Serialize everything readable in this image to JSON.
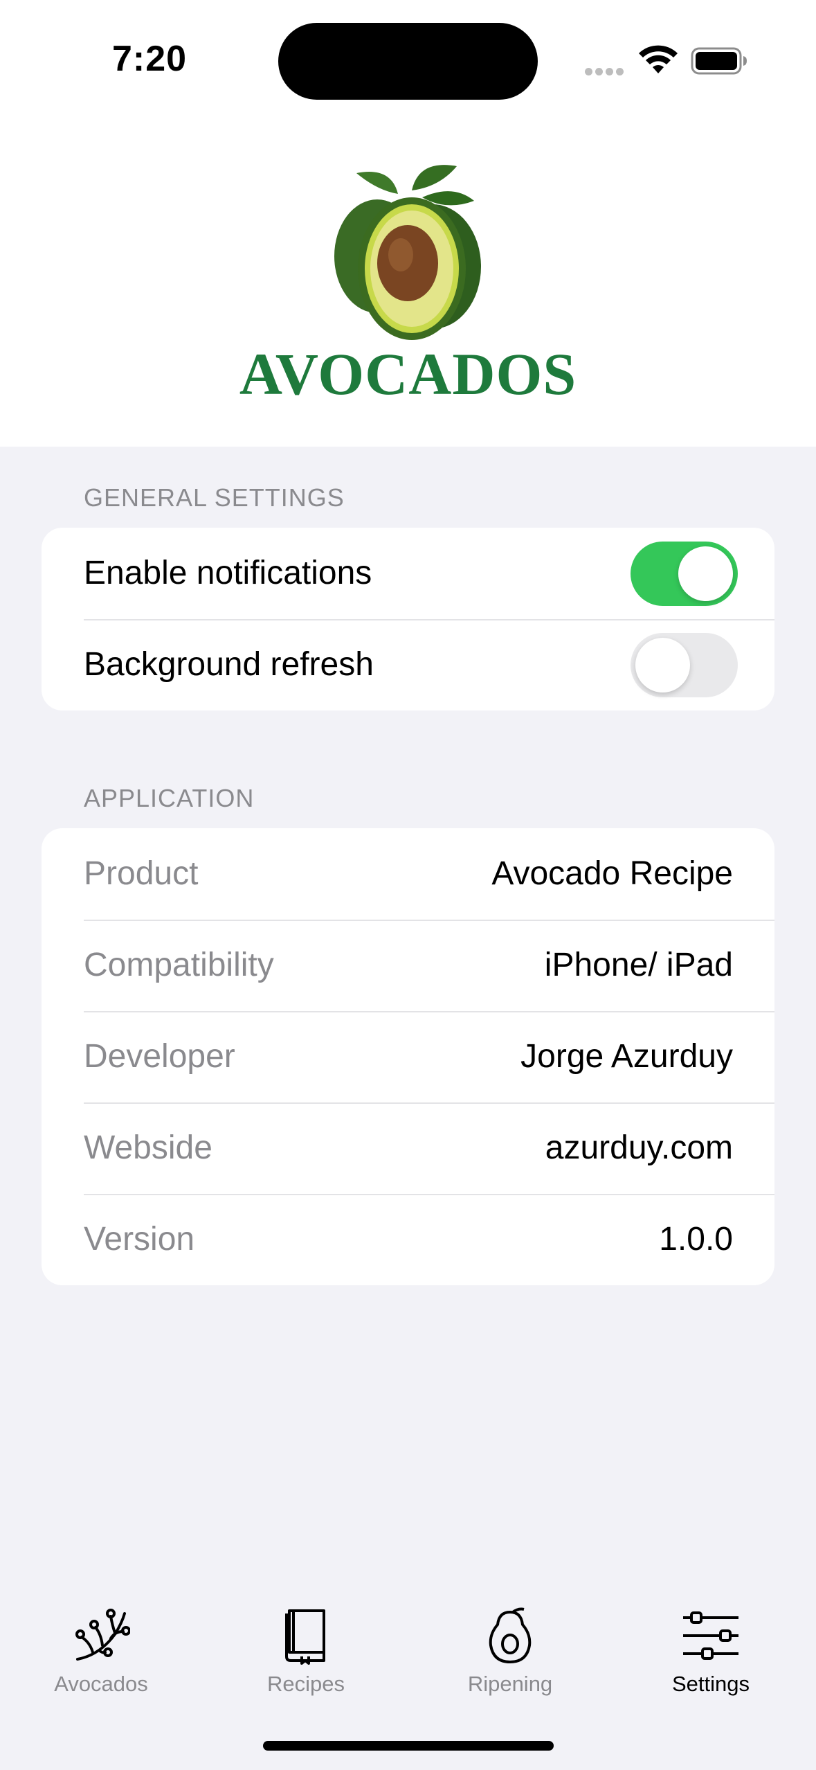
{
  "status_bar": {
    "time": "7:20"
  },
  "header": {
    "title": "AVOCADOS"
  },
  "general_settings": {
    "header": "GENERAL SETTINGS",
    "rows": [
      {
        "label": "Enable notifications",
        "on": true
      },
      {
        "label": "Background refresh",
        "on": false
      }
    ]
  },
  "application": {
    "header": "APPLICATION",
    "rows": [
      {
        "label": "Product",
        "value": "Avocado Recipe"
      },
      {
        "label": "Compatibility",
        "value": "iPhone/ iPad"
      },
      {
        "label": "Developer",
        "value": "Jorge Azurduy"
      },
      {
        "label": "Webside",
        "value": "azurduy.com"
      },
      {
        "label": "Version",
        "value": "1.0.0"
      }
    ]
  },
  "tab_bar": {
    "tabs": [
      {
        "label": "Avocados",
        "icon": "branch-icon"
      },
      {
        "label": "Recipes",
        "icon": "book-icon"
      },
      {
        "label": "Ripening",
        "icon": "avocado-icon"
      },
      {
        "label": "Settings",
        "icon": "sliders-icon",
        "active": true
      }
    ]
  },
  "colors": {
    "accent_green": "#1E7A3C",
    "toggle_on": "#34C759",
    "background": "#F2F2F7"
  }
}
